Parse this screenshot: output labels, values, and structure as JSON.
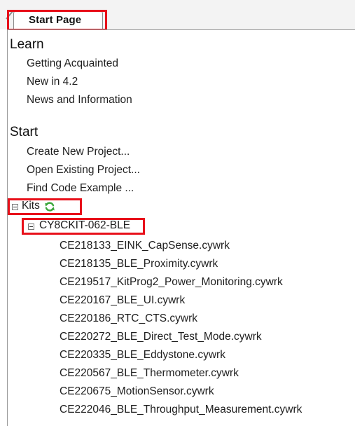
{
  "tab": {
    "label": "Start Page"
  },
  "learn": {
    "heading": "Learn",
    "items": [
      "Getting Acquainted",
      "New in 4.2",
      "News and Information"
    ]
  },
  "start": {
    "heading": "Start",
    "items": [
      "Create New Project...",
      "Open Existing Project...",
      "Find Code Example ..."
    ]
  },
  "kits": {
    "label": "Kits",
    "refresh_icon": "refresh-icon",
    "kit": {
      "name": "CY8CKIT-062-BLE",
      "files": [
        "CE218133_EINK_CapSense.cywrk",
        "CE218135_BLE_Proximity.cywrk",
        "CE219517_KitProg2_Power_Monitoring.cywrk",
        "CE220167_BLE_UI.cywrk",
        "CE220186_RTC_CTS.cywrk",
        "CE220272_BLE_Direct_Test_Mode.cywrk",
        "CE220335_BLE_Eddystone.cywrk",
        "CE220567_BLE_Thermometer.cywrk",
        "CE220675_MotionSensor.cywrk",
        "CE222046_BLE_Throughput_Measurement.cywrk"
      ]
    }
  },
  "colors": {
    "highlight": "#e8101a",
    "refresh_icon": "#3aa53a"
  }
}
